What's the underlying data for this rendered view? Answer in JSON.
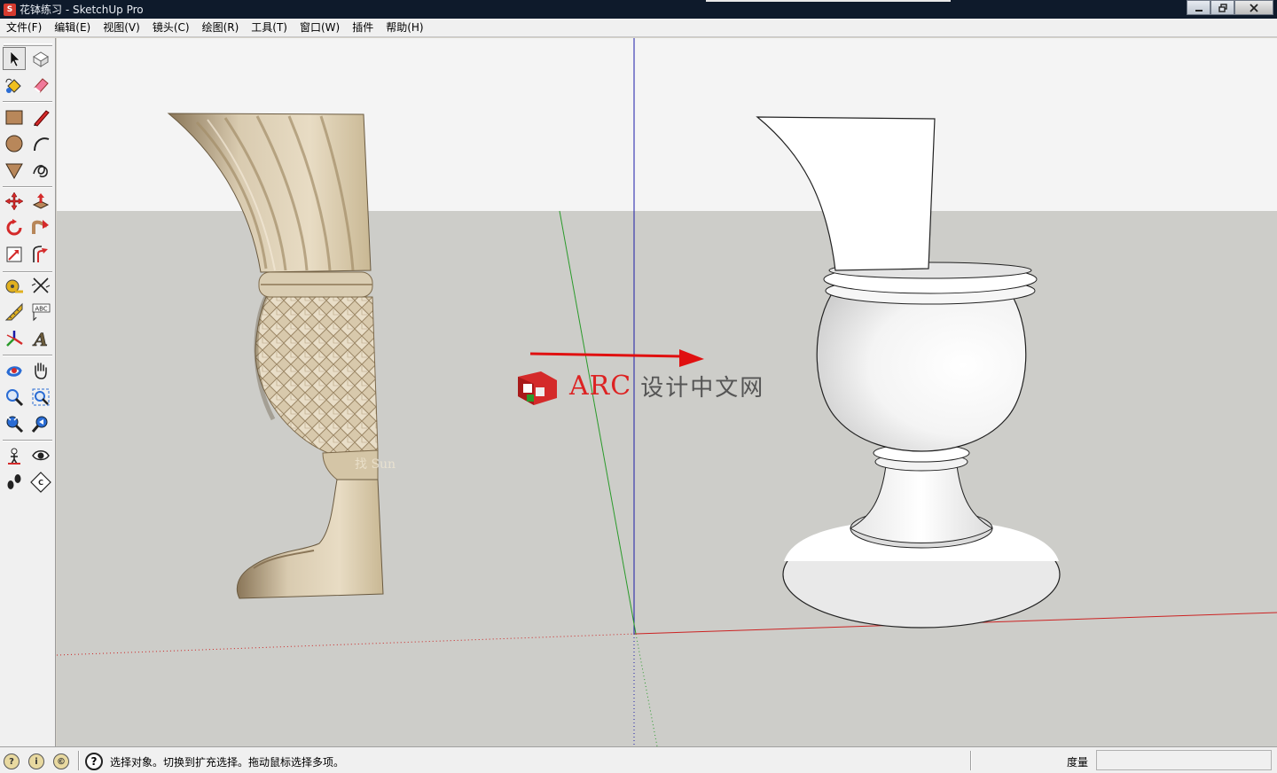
{
  "window": {
    "title": "花钵练习 - SketchUp Pro",
    "app_icon": "sketchup-icon",
    "buttons": [
      "minimize",
      "restore",
      "close"
    ]
  },
  "menu": {
    "items": [
      "文件(F)",
      "编辑(E)",
      "视图(V)",
      "镜头(C)",
      "绘图(R)",
      "工具(T)",
      "窗口(W)",
      "插件",
      "帮助(H)"
    ]
  },
  "toolbar": {
    "tools": [
      {
        "name": "select-tool",
        "icon": "arrow-icon"
      },
      {
        "name": "make-component-tool",
        "icon": "cube-icon"
      },
      {
        "name": "paint-bucket-tool",
        "icon": "paint-bucket-icon"
      },
      {
        "name": "eraser-tool",
        "icon": "eraser-icon"
      },
      {
        "name": "rectangle-tool",
        "icon": "rectangle-icon"
      },
      {
        "name": "line-tool",
        "icon": "pencil-icon"
      },
      {
        "name": "circle-tool",
        "icon": "circle-icon"
      },
      {
        "name": "arc-tool",
        "icon": "arc-icon"
      },
      {
        "name": "polygon-tool",
        "icon": "polygon-icon"
      },
      {
        "name": "freehand-tool",
        "icon": "freehand-icon"
      },
      {
        "name": "move-tool",
        "icon": "move-icon"
      },
      {
        "name": "push-pull-tool",
        "icon": "push-pull-icon"
      },
      {
        "name": "rotate-tool",
        "icon": "rotate-icon"
      },
      {
        "name": "follow-me-tool",
        "icon": "follow-me-icon"
      },
      {
        "name": "scale-tool",
        "icon": "scale-icon"
      },
      {
        "name": "offset-tool",
        "icon": "offset-icon"
      },
      {
        "name": "tape-measure-tool",
        "icon": "tape-measure-icon"
      },
      {
        "name": "dimension-tool",
        "icon": "dimension-icon"
      },
      {
        "name": "protractor-tool",
        "icon": "protractor-icon"
      },
      {
        "name": "text-tool",
        "icon": "text-icon"
      },
      {
        "name": "axes-tool",
        "icon": "axes-icon"
      },
      {
        "name": "3d-text-tool",
        "icon": "3d-text-icon"
      },
      {
        "name": "orbit-tool",
        "icon": "orbit-icon"
      },
      {
        "name": "pan-tool",
        "icon": "hand-icon"
      },
      {
        "name": "zoom-tool",
        "icon": "zoom-icon"
      },
      {
        "name": "zoom-window-tool",
        "icon": "zoom-window-icon"
      },
      {
        "name": "zoom-extents-tool",
        "icon": "zoom-extents-icon"
      },
      {
        "name": "previous-view-tool",
        "icon": "previous-view-icon"
      },
      {
        "name": "position-camera-tool",
        "icon": "position-camera-icon"
      },
      {
        "name": "look-around-tool",
        "icon": "eye-icon"
      },
      {
        "name": "walk-tool",
        "icon": "footprints-icon"
      },
      {
        "name": "section-plane-tool",
        "icon": "section-plane-icon"
      }
    ],
    "dimension_label": "ABC",
    "text_tool_label": "A",
    "section_label": "C"
  },
  "viewport": {
    "watermark_brand": "ARC",
    "watermark_text": "设计中文网",
    "image_watermark": "找 Sun",
    "colors": {
      "sky": "#f4f4f4",
      "ground": "#cdcdc9",
      "axis_red": "#cc2222",
      "axis_green": "#2a9a2a",
      "axis_blue": "#1a1aa8",
      "arrow": "#e01010",
      "vase_photo": "#d9cbb0"
    }
  },
  "status": {
    "icons": [
      "geo-location-icon",
      "credits-icon",
      "copyright-icon"
    ],
    "help_icon": "question-icon",
    "text": "选择对象。切换到扩充选择。拖动鼠标选择多项。",
    "measure_label": "度量",
    "measure_value": ""
  }
}
